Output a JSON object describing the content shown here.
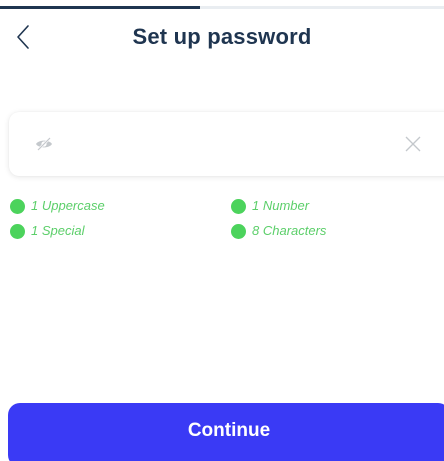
{
  "header": {
    "title": "Set up password",
    "back_icon": "chevron-left-icon",
    "progress_fraction": 0.45
  },
  "password_field": {
    "value": "",
    "placeholder": "",
    "visibility_icon": "eye-off-icon",
    "clear_icon": "close-icon"
  },
  "requirements": [
    {
      "label": "1 Uppercase",
      "met": true
    },
    {
      "label": "1 Number",
      "met": true
    },
    {
      "label": "1 Special",
      "met": true
    },
    {
      "label": "8 Characters",
      "met": true
    }
  ],
  "continue_label": "Continue",
  "colors": {
    "primary": "#3a3af5",
    "title": "#1f3550",
    "met": "#4cd35c",
    "met_text": "#5ccf6a",
    "icon_gray": "#c4c8cc"
  }
}
